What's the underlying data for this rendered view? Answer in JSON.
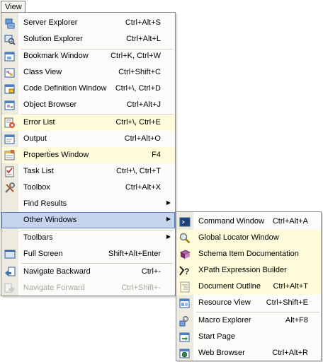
{
  "menubar": {
    "view_label": "View"
  },
  "view_menu": {
    "items": [
      {
        "label": "Server Explorer",
        "shortcut": "Ctrl+Alt+S",
        "icon": "server-explorer-icon"
      },
      {
        "label": "Solution Explorer",
        "shortcut": "Ctrl+Alt+L",
        "icon": "solution-explorer-icon"
      },
      {
        "label": "Bookmark Window",
        "shortcut": "Ctrl+K, Ctrl+W",
        "icon": "bookmark-window-icon"
      },
      {
        "label": "Class View",
        "shortcut": "Ctrl+Shift+C",
        "icon": "class-view-icon"
      },
      {
        "label": "Code Definition Window",
        "shortcut": "Ctrl+\\, Ctrl+D",
        "icon": "code-definition-icon"
      },
      {
        "label": "Object Browser",
        "shortcut": "Ctrl+Alt+J",
        "icon": "object-browser-icon"
      },
      {
        "label": "Error List",
        "shortcut": "Ctrl+\\, Ctrl+E",
        "icon": "error-list-icon"
      },
      {
        "label": "Output",
        "shortcut": "Ctrl+Alt+O",
        "icon": "output-icon"
      },
      {
        "label": "Properties Window",
        "shortcut": "F4",
        "icon": "properties-icon"
      },
      {
        "label": "Task List",
        "shortcut": "Ctrl+\\, Ctrl+T",
        "icon": "task-list-icon"
      },
      {
        "label": "Toolbox",
        "shortcut": "Ctrl+Alt+X",
        "icon": "toolbox-icon"
      },
      {
        "label": "Find Results",
        "shortcut": "",
        "icon": ""
      },
      {
        "label": "Other Windows",
        "shortcut": "",
        "icon": ""
      },
      {
        "label": "Toolbars",
        "shortcut": "",
        "icon": ""
      },
      {
        "label": "Full Screen",
        "shortcut": "Shift+Alt+Enter",
        "icon": "full-screen-icon"
      },
      {
        "label": "Navigate Backward",
        "shortcut": "Ctrl+-",
        "icon": "navigate-backward-icon"
      },
      {
        "label": "Navigate Forward",
        "shortcut": "Ctrl+Shift+-",
        "icon": "navigate-forward-icon",
        "disabled": true
      }
    ]
  },
  "other_windows_menu": {
    "items": [
      {
        "label": "Command Window",
        "shortcut": "Ctrl+Alt+A",
        "icon": "command-window-icon"
      },
      {
        "label": "Global Locator Window",
        "shortcut": "",
        "icon": "global-locator-icon"
      },
      {
        "label": "Schema Item Documentation",
        "shortcut": "",
        "icon": "schema-item-icon"
      },
      {
        "label": "XPath Expression Builder",
        "shortcut": "",
        "icon": "xpath-builder-icon"
      },
      {
        "label": "Document Outline",
        "shortcut": "Ctrl+Alt+T",
        "icon": "document-outline-icon"
      },
      {
        "label": "Resource View",
        "shortcut": "Ctrl+Shift+E",
        "icon": "resource-view-icon"
      },
      {
        "label": "Macro Explorer",
        "shortcut": "Alt+F8",
        "icon": "macro-explorer-icon"
      },
      {
        "label": "Start Page",
        "shortcut": "",
        "icon": "start-page-icon"
      },
      {
        "label": "Web Browser",
        "shortcut": "Ctrl+Alt+R",
        "icon": "web-browser-icon"
      }
    ]
  },
  "colors": {
    "highlight_row": "#fdfbd9",
    "active_row": "#c5d3ec",
    "active_border": "#5d7fbe",
    "gutter": "#edeae0",
    "disabled_text": "#a8a8a0"
  }
}
